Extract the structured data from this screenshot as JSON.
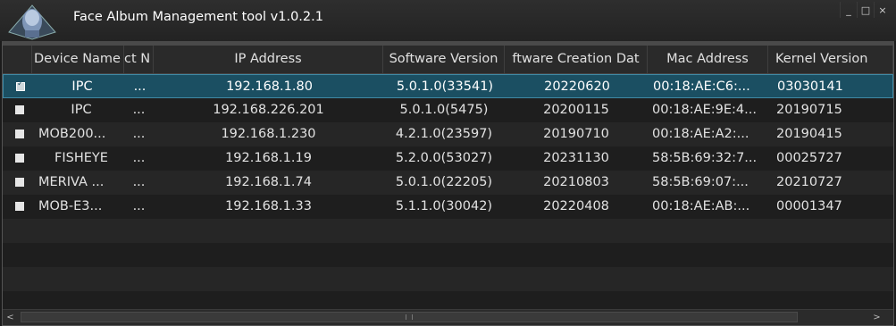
{
  "window": {
    "title": "Face Album Management tool v1.0.2.1",
    "buttons": {
      "minimize": "_",
      "maximize": "□",
      "close": "×"
    }
  },
  "table": {
    "columns": [
      "Device Name",
      "ct N",
      "IP Address",
      "Software Version",
      "ftware Creation Dat",
      "Mac Address",
      "Kernel Version"
    ],
    "rows": [
      {
        "checked": true,
        "name": "IPC",
        "ct": "...",
        "ip": "192.168.1.80",
        "sw": "5.0.1.0(33541)",
        "date": "20220620",
        "mac": "00:18:AE:C6:...",
        "kernel": "03030141"
      },
      {
        "checked": false,
        "name": "IPC",
        "ct": "...",
        "ip": "192.168.226.201",
        "sw": "5.0.1.0(5475)",
        "date": "20200115",
        "mac": "00:18:AE:9E:4...",
        "kernel": "20190715"
      },
      {
        "checked": false,
        "name": "MOB200...",
        "ct": "...",
        "ip": "192.168.1.230",
        "sw": "4.2.1.0(23597)",
        "date": "20190710",
        "mac": "00:18:AE:A2:...",
        "kernel": "20190415"
      },
      {
        "checked": false,
        "name": "FISHEYE",
        "ct": "...",
        "ip": "192.168.1.19",
        "sw": "5.2.0.0(53027)",
        "date": "20231130",
        "mac": "58:5B:69:32:7...",
        "kernel": "00025727"
      },
      {
        "checked": false,
        "name": "MERIVA ...",
        "ct": "...",
        "ip": "192.168.1.74",
        "sw": "5.0.1.0(22205)",
        "date": "20210803",
        "mac": "58:5B:69:07:...",
        "kernel": "20210727"
      },
      {
        "checked": false,
        "name": "MOB-E3...",
        "ct": "...",
        "ip": "192.168.1.33",
        "sw": "5.1.1.0(30042)",
        "date": "20220408",
        "mac": "00:18:AE:AB:...",
        "kernel": "00001347"
      }
    ]
  },
  "scrollbar": {
    "left_arrow": "<",
    "right_arrow": ">"
  }
}
